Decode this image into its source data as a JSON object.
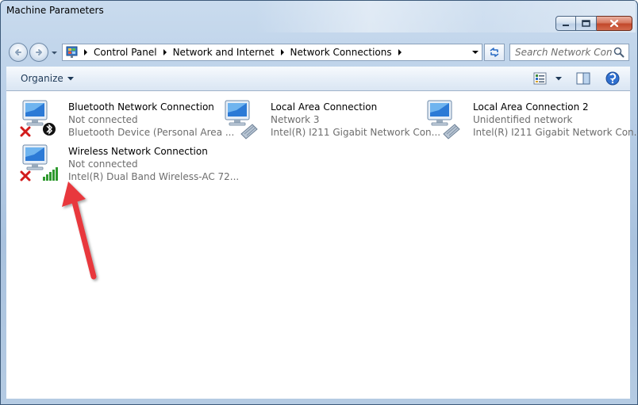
{
  "window": {
    "title": "Machine Parameters"
  },
  "address": {
    "crumbs": [
      "Control Panel",
      "Network and Internet",
      "Network Connections"
    ],
    "search_placeholder": "Search Network Con..."
  },
  "toolbar": {
    "organize_label": "Organize"
  },
  "connections": [
    {
      "name": "Bluetooth Network Connection",
      "status": "Not connected",
      "device": "Bluetooth Device (Personal Area ...",
      "icon": "bluetooth-network-icon",
      "disabled": true
    },
    {
      "name": "Local Area Connection",
      "status": "Network  3",
      "device": "Intel(R) I211 Gigabit Network Con...",
      "icon": "wired-network-icon",
      "disabled": false
    },
    {
      "name": "Local Area Connection 2",
      "status": "Unidentified network",
      "device": "Intel(R) I211 Gigabit Network Con...",
      "icon": "wired-network-icon",
      "disabled": false
    },
    {
      "name": "Wireless Network Connection",
      "status": "Not connected",
      "device": "Intel(R) Dual Band Wireless-AC 72...",
      "icon": "wireless-network-icon",
      "disabled": true
    }
  ],
  "colors": {
    "annotation_arrow": "#e8383d",
    "disabled_x": "#d21c1c",
    "signal_green": "#2f9a2f"
  }
}
